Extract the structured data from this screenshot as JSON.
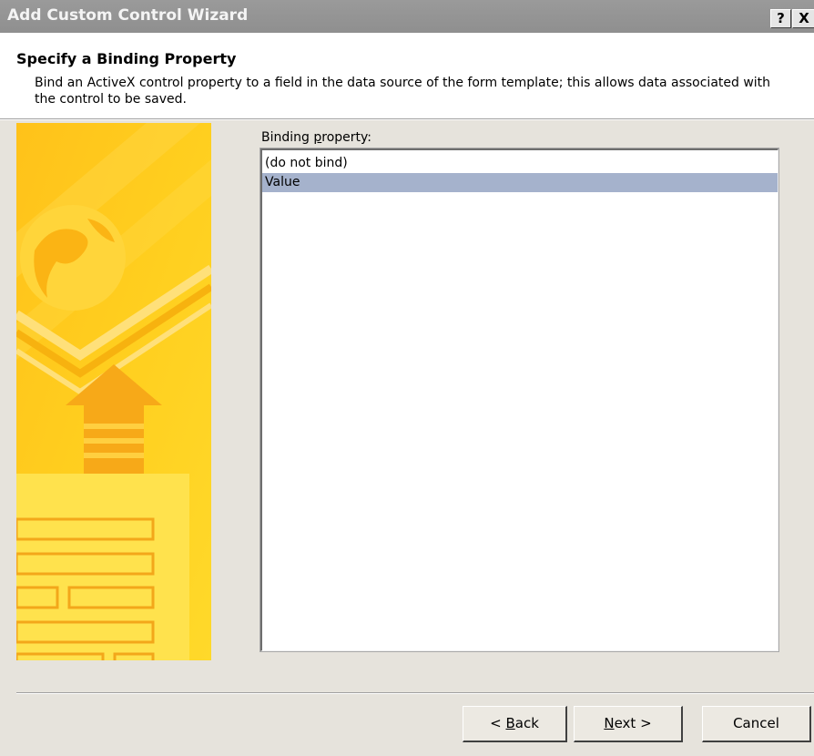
{
  "window": {
    "title": "Add Custom Control Wizard",
    "help_label": "?",
    "close_label": "X"
  },
  "header": {
    "title": "Specify a Binding Property",
    "description": "Bind an ActiveX control property to a field in the data source of the form template; this allows data associated with the control to be saved."
  },
  "binding": {
    "label_prefix": "Binding ",
    "label_accel": "p",
    "label_suffix": "roperty:",
    "options": [
      {
        "label": "(do not bind)",
        "selected": false
      },
      {
        "label": "Value",
        "selected": true
      }
    ]
  },
  "buttons": {
    "back": {
      "prefix": "< ",
      "accel": "B",
      "suffix": "ack"
    },
    "next": {
      "accel": "N",
      "suffix": "ext >"
    },
    "cancel": {
      "label": "Cancel"
    }
  },
  "colors": {
    "titlebar": "#8f8f8f",
    "selection": "#a5b2cc",
    "dialog_bg": "#e6e3dc",
    "art_yellow": "#ffcc00"
  },
  "icons": [
    "help-icon",
    "close-icon",
    "wizard-art"
  ]
}
